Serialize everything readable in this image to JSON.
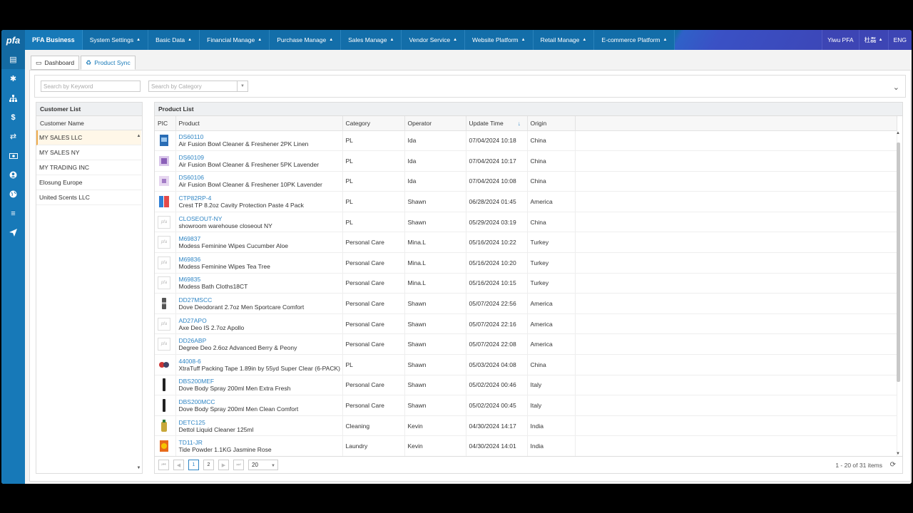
{
  "brand": "PFA Business",
  "logo_text": "pfa",
  "menu": [
    {
      "label": "System Settings"
    },
    {
      "label": "Basic Data"
    },
    {
      "label": "Financial Manage"
    },
    {
      "label": "Purchase Manage"
    },
    {
      "label": "Sales Manage"
    },
    {
      "label": "Vendor Service"
    },
    {
      "label": "Website Platform"
    },
    {
      "label": "Retail Manage"
    },
    {
      "label": "E-commerce Platform"
    }
  ],
  "user_nav": {
    "company": "Yiwu PFA",
    "user": "杜磊",
    "language": "ENG"
  },
  "sidebar_icons": [
    "list-icon",
    "gear-icon",
    "sitemap-icon",
    "dollar-icon",
    "sync-icon",
    "money-icon",
    "user-circle-icon",
    "globe-icon",
    "menu-icon",
    "send-icon"
  ],
  "tabs": [
    {
      "label": "Dashboard",
      "icon": "monitor-icon"
    },
    {
      "label": "Product Sync",
      "icon": "recycle-icon"
    }
  ],
  "search": {
    "keyword_placeholder": "Search by Keyword",
    "category_placeholder": "Search by Category"
  },
  "customer_list": {
    "title": "Customer List",
    "column": "Customer Name",
    "items": [
      "MY SALES LLC",
      "MY SALES NY",
      "MY TRADING INC",
      "Elosung Europe",
      "United Scents LLC"
    ],
    "selected": "MY SALES LLC"
  },
  "product_list": {
    "title": "Product List",
    "columns": {
      "pic": "PIC",
      "product": "Product",
      "category": "Category",
      "operator": "Operator",
      "update_time": "Update Time",
      "origin": "Origin"
    },
    "rows": [
      {
        "sku": "DS60110",
        "name": "Air Fusion Bowl Cleaner & Freshener 2PK Linen",
        "category": "PL",
        "operator": "Ida",
        "time": "07/04/2024 10:18",
        "origin": "China",
        "pic": "img-blue"
      },
      {
        "sku": "DS60109",
        "name": "Air Fusion Bowl Cleaner & Freshener 5PK Lavender",
        "category": "PL",
        "operator": "Ida",
        "time": "07/04/2024 10:17",
        "origin": "China",
        "pic": "img-purple"
      },
      {
        "sku": "DS60106",
        "name": "Air Fusion Bowl Cleaner & Freshener 10PK Lavender",
        "category": "PL",
        "operator": "Ida",
        "time": "07/04/2024 10:08",
        "origin": "China",
        "pic": "img-lilac"
      },
      {
        "sku": "CTP82RP-4",
        "name": "Crest TP 8.2oz Cavity Protection Paste 4 Pack",
        "category": "PL",
        "operator": "Shawn",
        "time": "06/28/2024 01:45",
        "origin": "America",
        "pic": "img-crest"
      },
      {
        "sku": "CLOSEOUT-NY",
        "name": "showroom warehouse closeout NY",
        "category": "PL",
        "operator": "Shawn",
        "time": "05/29/2024 03:19",
        "origin": "China",
        "pic": "placeholder"
      },
      {
        "sku": "M69837",
        "name": "Modess Feminine Wipes Cucumber Aloe",
        "category": "Personal Care",
        "operator": "Mina.L",
        "time": "05/16/2024 10:22",
        "origin": "Turkey",
        "pic": "placeholder"
      },
      {
        "sku": "M69836",
        "name": "Modess Feminine Wipes Tea Tree",
        "category": "Personal Care",
        "operator": "Mina.L",
        "time": "05/16/2024 10:20",
        "origin": "Turkey",
        "pic": "placeholder"
      },
      {
        "sku": "M69835",
        "name": "Modess Bath Cloths18CT",
        "category": "Personal Care",
        "operator": "Mina.L",
        "time": "05/16/2024 10:15",
        "origin": "Turkey",
        "pic": "placeholder"
      },
      {
        "sku": "DD27MSCC",
        "name": "Dove Deodorant 2.7oz Men Sportcare Comfort",
        "category": "Personal Care",
        "operator": "Shawn",
        "time": "05/07/2024 22:56",
        "origin": "America",
        "pic": "img-deo"
      },
      {
        "sku": "AD27APO",
        "name": "Axe Deo IS 2.7oz Apollo",
        "category": "Personal Care",
        "operator": "Shawn",
        "time": "05/07/2024 22:16",
        "origin": "America",
        "pic": "placeholder"
      },
      {
        "sku": "DD26ABP",
        "name": "Degree Deo 2.6oz Advanced Berry & Peony",
        "category": "Personal Care",
        "operator": "Shawn",
        "time": "05/07/2024 22:08",
        "origin": "America",
        "pic": "placeholder"
      },
      {
        "sku": "44008-6",
        "name": "XtraTuff Packing Tape 1.89in by 55yd Super Clear (6-PACK)",
        "category": "PL",
        "operator": "Shawn",
        "time": "05/03/2024 04:08",
        "origin": "China",
        "pic": "img-tape"
      },
      {
        "sku": "DBS200MEF",
        "name": "Dove Body Spray 200ml Men Extra Fresh",
        "category": "Personal Care",
        "operator": "Shawn",
        "time": "05/02/2024 00:46",
        "origin": "Italy",
        "pic": "img-spray"
      },
      {
        "sku": "DBS200MCC",
        "name": "Dove Body Spray 200ml Men Clean Comfort",
        "category": "Personal Care",
        "operator": "Shawn",
        "time": "05/02/2024 00:45",
        "origin": "Italy",
        "pic": "img-spray"
      },
      {
        "sku": "DETC125",
        "name": "Dettol Liquid Cleaner 125ml",
        "category": "Cleaning",
        "operator": "Kevin",
        "time": "04/30/2024 14:17",
        "origin": "India",
        "pic": "img-dettol"
      },
      {
        "sku": "TD11-JR",
        "name": "Tide Powder 1.1KG Jasmine Rose",
        "category": "Laundry",
        "operator": "Kevin",
        "time": "04/30/2024 14:01",
        "origin": "India",
        "pic": "img-tide"
      }
    ]
  },
  "pager": {
    "pages": [
      "1",
      "2"
    ],
    "current": "1",
    "page_size": "20",
    "info": "1 - 20 of 31 items"
  },
  "colors": {
    "nav": "#1779b8",
    "link": "#2f85c4",
    "selected_row": "#fff7e8"
  }
}
